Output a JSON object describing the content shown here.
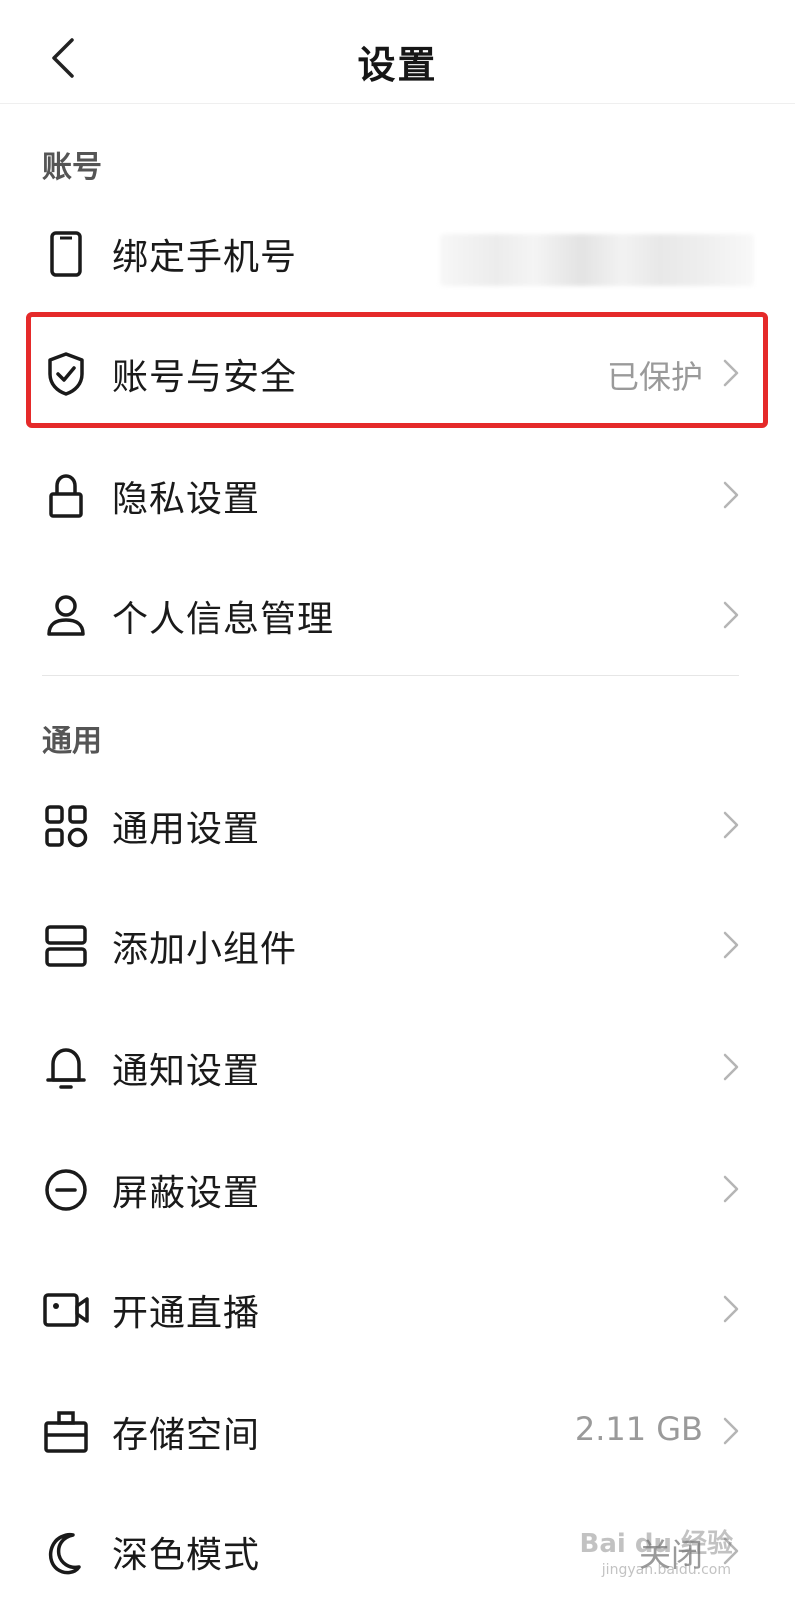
{
  "header": {
    "title": "设置"
  },
  "sections": {
    "account": "账号",
    "general": "通用"
  },
  "rows": {
    "bind_phone": {
      "label": "绑定手机号"
    },
    "account_security": {
      "label": "账号与安全",
      "value": "已保护"
    },
    "privacy": {
      "label": "隐私设置"
    },
    "personal_info": {
      "label": "个人信息管理"
    },
    "general_settings": {
      "label": "通用设置"
    },
    "widgets": {
      "label": "添加小组件"
    },
    "notifications": {
      "label": "通知设置"
    },
    "block": {
      "label": "屏蔽设置"
    },
    "live": {
      "label": "开通直播"
    },
    "storage": {
      "label": "存储空间",
      "value": "2.11 GB"
    },
    "dark_mode": {
      "label": "深色模式",
      "value": "关闭"
    }
  },
  "watermark": {
    "text": "Bai du 经验",
    "sub": "jingyan.baidu.com"
  },
  "colors": {
    "highlight": "#e52a2a",
    "text": "#1a1a1a",
    "secondary": "#9a9a9a"
  },
  "icons": {
    "back": "chevron-left-icon",
    "bind_phone": "phone-icon",
    "account_security": "shield-check-icon",
    "privacy": "lock-icon",
    "personal_info": "user-icon",
    "general_settings": "grid-icon",
    "widgets": "widget-icon",
    "notifications": "bell-icon",
    "block": "minus-circle-icon",
    "live": "video-camera-icon",
    "storage": "briefcase-icon",
    "dark_mode": "moon-icon",
    "chevron": "chevron-right-icon"
  }
}
